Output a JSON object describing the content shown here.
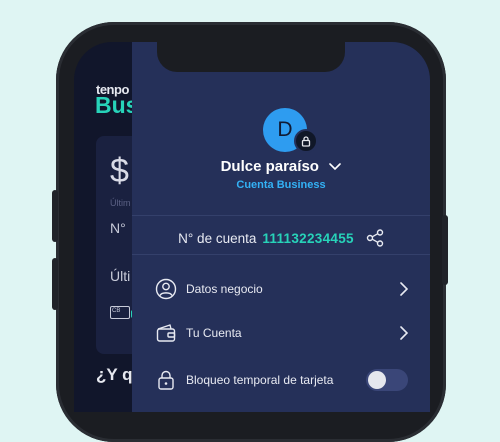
{
  "background_app": {
    "logo_top": "tenpo",
    "logo_bottom": "Bus",
    "balance_symbol": "$",
    "ultim_text": "Últim",
    "no_text": "N°",
    "ultim2_text": "Últi",
    "chip_label": "CB",
    "question_text": "¿Y q"
  },
  "profile": {
    "avatar_initial": "D",
    "name": "Dulce paraíso",
    "account_type": "Cuenta Business"
  },
  "account": {
    "label": "N° de cuenta",
    "number": "111132234455"
  },
  "menu": {
    "items": [
      {
        "label": "Datos negocio",
        "icon": "user-icon"
      },
      {
        "label": "Tu Cuenta",
        "icon": "wallet-icon"
      },
      {
        "label": "Bloqueo temporal de tarjeta",
        "icon": "lock-icon",
        "toggle_on": false
      }
    ]
  },
  "colors": {
    "drawer_bg": "#253059",
    "accent_teal": "#27d3b9",
    "accent_blue": "#33b1f5",
    "avatar_bg": "#2e9cf0",
    "page_bg": "#dff5f3"
  }
}
